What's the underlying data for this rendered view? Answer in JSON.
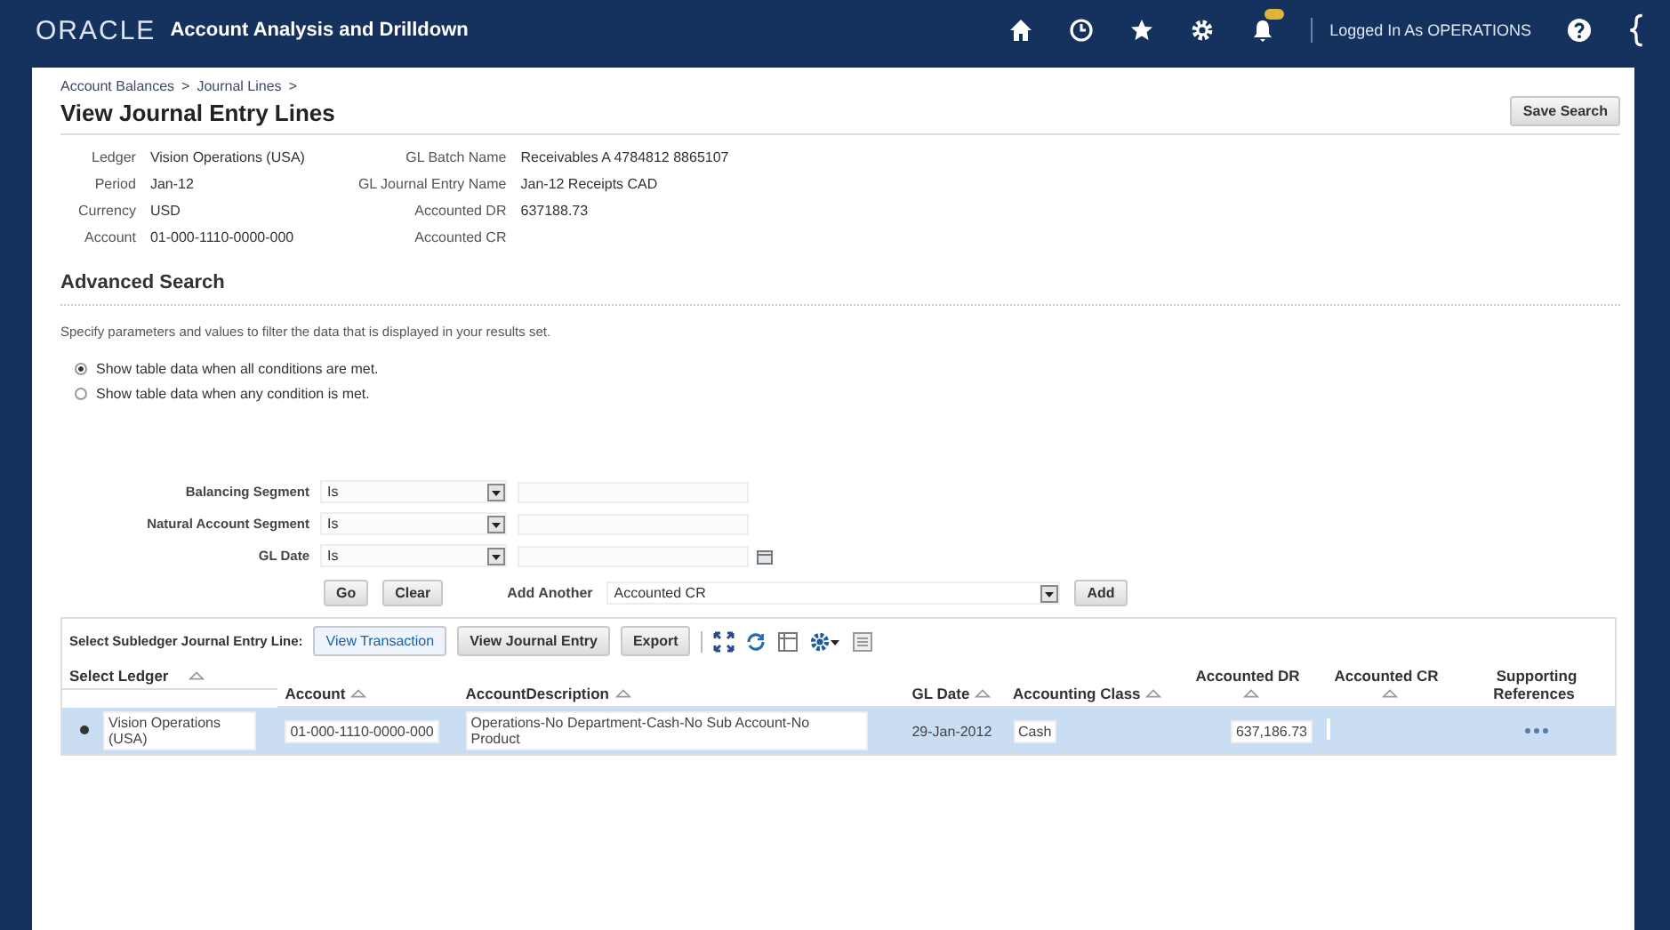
{
  "header": {
    "logo": "ORACLE",
    "app_title": "Account Analysis and Drilldown",
    "user": "Logged In As OPERATIONS"
  },
  "breadcrumbs": [
    {
      "label": "Account Balances",
      "separator": ">"
    },
    {
      "label": "Journal Lines",
      "separator": ">"
    }
  ],
  "page_title": "View Journal Entry Lines",
  "save_button": "Save Search",
  "summary_left": [
    {
      "label": "Ledger",
      "value": "Vision Operations (USA)"
    },
    {
      "label": "Period",
      "value": "Jan-12"
    },
    {
      "label": "Currency",
      "value": "USD"
    },
    {
      "label": "Account",
      "value": "01-000-1110-0000-000"
    }
  ],
  "summary_right": [
    {
      "label": "GL Batch Name",
      "value": "Receivables A 4784812 8865107"
    },
    {
      "label": "GL Journal Entry Name",
      "value": "Jan-12 Receipts CAD"
    },
    {
      "label": "Accounted DR",
      "value": "637188.73"
    },
    {
      "label": "Accounted CR"
    }
  ],
  "advanced_search": {
    "title": "Advanced Search",
    "description": "Specify parameters and values to filter the data that is displayed in your results set.",
    "match_options": [
      {
        "label": "Show table data when all conditions are met.",
        "selected": true
      },
      {
        "label": "Show table data when any condition is met.",
        "selected": false
      }
    ],
    "conditions": [
      {
        "label": "Balancing Segment",
        "operator": "Is",
        "kind": "text"
      },
      {
        "label": "Natural Account Segment",
        "operator": "Is",
        "kind": "text"
      },
      {
        "label": "GL Date",
        "operator": "Is",
        "kind": "date"
      }
    ],
    "go_button": "Go",
    "clear_button": "Clear",
    "add_another_label": "Add Another",
    "add_another_value": "Accounted CR",
    "add_button": "Add"
  },
  "toolbar": {
    "label": "Select Subledger Journal Entry Line:",
    "buttons": [
      {
        "label": "View Transaction",
        "hovered": true
      },
      {
        "label": "View Journal Entry",
        "hovered": false
      },
      {
        "label": "Export",
        "hovered": false
      }
    ]
  },
  "table": {
    "columns": [
      {
        "label": "Select Ledger",
        "sortable": true
      },
      {
        "label": "Account",
        "sortable": true
      },
      {
        "label": "AccountDescription",
        "sortable": true
      },
      {
        "label": "GL Date",
        "sortable": true
      },
      {
        "label": "Accounting Class",
        "sortable": true
      },
      {
        "label": "Accounted DR",
        "sortable": true
      },
      {
        "label": "Accounted CR",
        "sortable": true
      },
      {
        "label": "Supporting References",
        "sortable": false
      }
    ],
    "rows": [
      {
        "selected": true,
        "ledger": "Vision Operations (USA)",
        "account": "01-000-1110-0000-000",
        "description": "Operations-No Department-Cash-No Sub Account-No Product",
        "gl_date": "29-Jan-2012",
        "accounting_class": "Cash",
        "accounted_dr": "637,186.73"
      }
    ]
  }
}
